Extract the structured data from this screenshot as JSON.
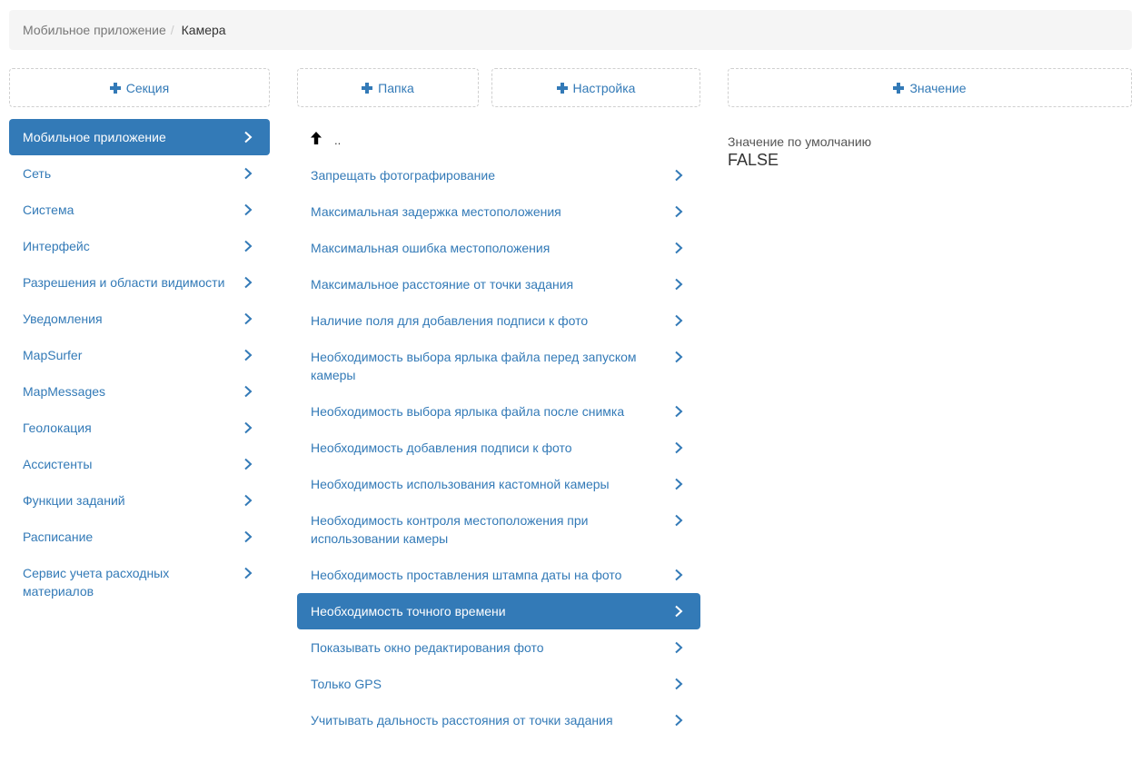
{
  "breadcrumb": {
    "parent": "Мобильное приложение",
    "separator": "/",
    "current": "Камера"
  },
  "buttons": {
    "section": "Секция",
    "folder": "Папка",
    "setting": "Настройка",
    "value": "Значение"
  },
  "sections": [
    {
      "label": "Мобильное приложение"
    },
    {
      "label": "Сеть"
    },
    {
      "label": "Система"
    },
    {
      "label": "Интерфейс"
    },
    {
      "label": "Разрешения и области видимости"
    },
    {
      "label": "Уведомления"
    },
    {
      "label": "MapSurfer"
    },
    {
      "label": "MapMessages"
    },
    {
      "label": "Геолокация"
    },
    {
      "label": "Ассистенты"
    },
    {
      "label": "Функции заданий"
    },
    {
      "label": "Расписание"
    },
    {
      "label": "Сервис учета расходных материалов"
    }
  ],
  "settings": {
    "up_label": "..",
    "items": [
      {
        "label": "Запрещать фотографирование"
      },
      {
        "label": "Максимальная задержка местоположения"
      },
      {
        "label": "Максимальная ошибка местоположения"
      },
      {
        "label": "Максимальное расстояние от точки задания"
      },
      {
        "label": "Наличие поля для добавления подписи к фото"
      },
      {
        "label": "Необходимость выбора ярлыка файла перед запуском камеры"
      },
      {
        "label": "Необходимость выбора ярлыка файла после снимка"
      },
      {
        "label": "Необходимость добавления подписи к фото"
      },
      {
        "label": "Необходимость использования кастомной камеры"
      },
      {
        "label": "Необходимость контроля местоположения при использовании камеры"
      },
      {
        "label": "Необходимость проставления штампа даты на фото"
      },
      {
        "label": "Необходимость точного времени"
      },
      {
        "label": "Показывать окно редактирования фото"
      },
      {
        "label": "Только GPS"
      },
      {
        "label": "Учитывать дальность расстояния от точки задания"
      }
    ]
  },
  "value_panel": {
    "label": "Значение по умолчанию",
    "value": "FALSE"
  },
  "colors": {
    "accent": "#337ab7",
    "breadcrumb_bg": "#f5f5f5",
    "active_text": "#ffffff"
  },
  "icons": {
    "add": "plus-icon",
    "navigate": "chevron-right-icon",
    "up": "arrow-up-icon"
  }
}
